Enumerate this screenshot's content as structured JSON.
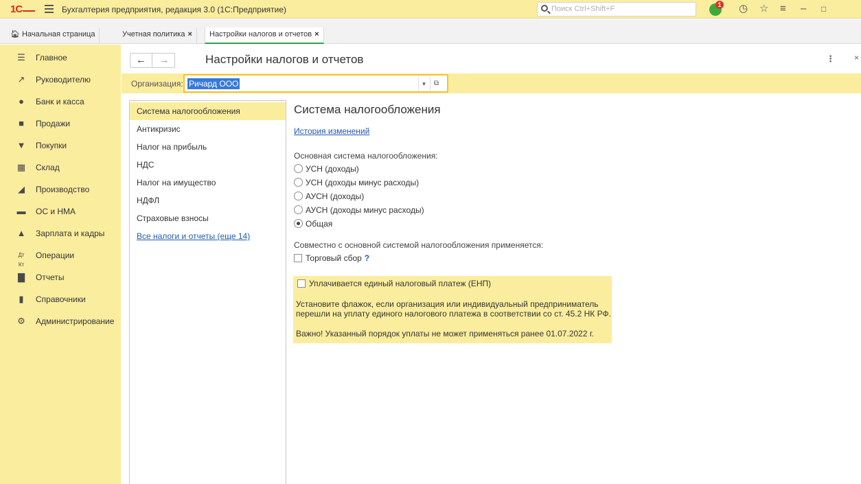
{
  "app": {
    "logo": "1С",
    "title": "Бухгалтерия предприятия, редакция 3.0  (1С:Предприятие)",
    "search_placeholder": "Поиск Ctrl+Shift+F",
    "notification_count": "1"
  },
  "tabs": [
    {
      "label": "Начальная страница",
      "closable": false
    },
    {
      "label": "Учетная политика",
      "closable": true
    },
    {
      "label": "Настройки налогов и отчетов",
      "closable": true,
      "active": true
    }
  ],
  "sidebar": {
    "items": [
      {
        "label": "Главное",
        "icon": "menu-icon"
      },
      {
        "label": "Руководителю",
        "icon": "trend-icon"
      },
      {
        "label": "Банк и касса",
        "icon": "coin-icon"
      },
      {
        "label": "Продажи",
        "icon": "bag-icon"
      },
      {
        "label": "Покупки",
        "icon": "cart-icon"
      },
      {
        "label": "Склад",
        "icon": "warehouse-icon"
      },
      {
        "label": "Производство",
        "icon": "factory-icon"
      },
      {
        "label": "ОС и НМА",
        "icon": "truck-icon"
      },
      {
        "label": "Зарплата и кадры",
        "icon": "person-icon"
      },
      {
        "label": "Операции",
        "icon": "dt-kt-icon"
      },
      {
        "label": "Отчеты",
        "icon": "bar-chart-icon"
      },
      {
        "label": "Справочники",
        "icon": "book-icon"
      },
      {
        "label": "Администрирование",
        "icon": "gear-icon"
      }
    ]
  },
  "page": {
    "title": "Настройки налогов и отчетов",
    "org_label": "Организация:",
    "org_value": "Ричард ООО"
  },
  "sections": {
    "items": [
      {
        "label": "Система налогообложения",
        "active": true
      },
      {
        "label": "Антикризис"
      },
      {
        "label": "Налог на прибыль"
      },
      {
        "label": "НДС"
      },
      {
        "label": "Налог на имущество"
      },
      {
        "label": "НДФЛ"
      },
      {
        "label": "Страховые взносы"
      }
    ],
    "all_link": "Все налоги и отчеты (еще 14)"
  },
  "content": {
    "title": "Система налогообложения",
    "history_link": "История изменений",
    "main_system_label": "Основная система налогообложения:",
    "options": [
      {
        "label": "УСН (доходы)",
        "selected": false
      },
      {
        "label": "УСН (доходы минус расходы)",
        "selected": false
      },
      {
        "label": "АУСН (доходы)",
        "selected": false
      },
      {
        "label": "АУСН (доходы минус расходы)",
        "selected": false
      },
      {
        "label": "Общая",
        "selected": true
      }
    ],
    "combined_label": "Совместно с основной системой налогообложения применяется:",
    "trade_fee_label": "Торговый сбор",
    "help_mark": "?",
    "enp": {
      "checkbox_label": "Уплачивается единый налоговый платеж (ЕНП)",
      "checked": false,
      "info_line1": "Установите флажок, если организация или индивидуальный предприниматель",
      "info_line2": "перешли на уплату единого налогового платежа в соответствии со ст. 45.2 НК РФ.",
      "warning": "Важно! Указанный порядок уплаты не может применяться ранее 01.07.2022 г."
    }
  },
  "colors": {
    "accent_yellow": "#fbed9e",
    "link_blue": "#2159b5",
    "logo_red": "#d62a1e",
    "active_tab_underline": "#2aa44c"
  }
}
